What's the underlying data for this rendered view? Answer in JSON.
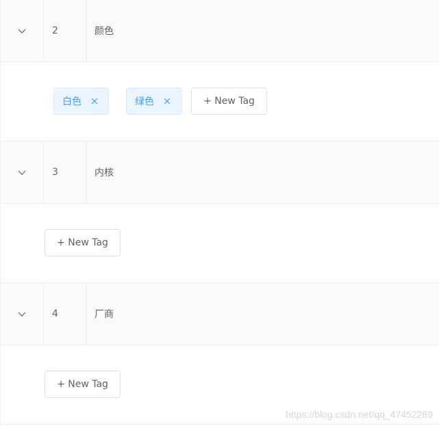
{
  "rows": [
    {
      "id": "2",
      "name": "颜色",
      "tags": [
        "白色",
        "绿色"
      ],
      "new_tag_label": "+ New Tag"
    },
    {
      "id": "3",
      "name": "内核",
      "tags": [],
      "new_tag_label": "+ New Tag"
    },
    {
      "id": "4",
      "name": "厂商",
      "tags": [],
      "new_tag_label": "+ New Tag"
    }
  ],
  "watermark": "https://blog.csdn.net/qq_47452289",
  "icons": {
    "expand": "chevron-down-icon",
    "close": "close-icon"
  },
  "colors": {
    "tag_text": "#409eff",
    "tag_bg": "#ecf5ff",
    "tag_border": "#d9ecff",
    "row_bg": "#fafafa"
  }
}
